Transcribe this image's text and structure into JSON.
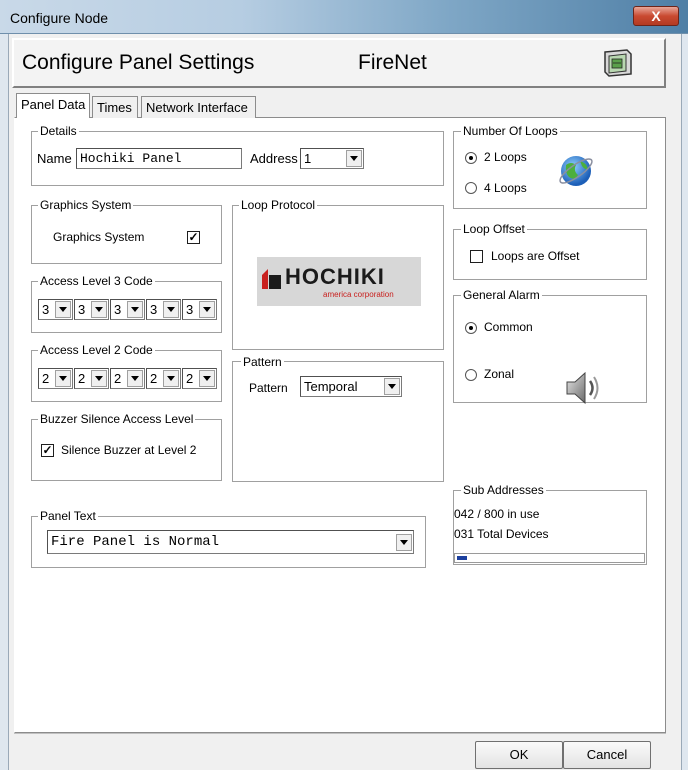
{
  "window": {
    "title": "Configure Node",
    "close_label": "X"
  },
  "header": {
    "title": "Configure Panel Settings",
    "network": "FireNet"
  },
  "tabs": [
    "Panel Data",
    "Times",
    "Network Interface"
  ],
  "details": {
    "label": "Details",
    "name_label": "Name",
    "name_value": "Hochiki Panel",
    "address_label": "Address",
    "address_value": "1"
  },
  "number_of_loops": {
    "label": "Number Of Loops",
    "options": [
      "2 Loops",
      "4 Loops"
    ],
    "selected": "2 Loops"
  },
  "graphics_system": {
    "label": "Graphics System",
    "checkbox_label": "Graphics System",
    "checked": true
  },
  "loop_protocol": {
    "label": "Loop Protocol",
    "logo_text": "HOCHIKI",
    "logo_sub": "america corporation"
  },
  "loop_offset": {
    "label": "Loop Offset",
    "checkbox_label": "Loops are Offset",
    "checked": false
  },
  "access_level_3": {
    "label": "Access Level 3 Code",
    "digits": [
      "3",
      "3",
      "3",
      "3",
      "3"
    ]
  },
  "access_level_2": {
    "label": "Access Level 2 Code",
    "digits": [
      "2",
      "2",
      "2",
      "2",
      "2"
    ]
  },
  "general_alarm": {
    "label": "General Alarm",
    "options": [
      "Common",
      "Zonal"
    ],
    "selected": "Common"
  },
  "pattern": {
    "label": "Pattern",
    "field_label": "Pattern",
    "value": "Temporal"
  },
  "buzzer": {
    "label": "Buzzer Silence Access Level",
    "checkbox_label": "Silence Buzzer at Level 2",
    "checked": true
  },
  "sub_addresses": {
    "label": "Sub Addresses",
    "in_use": "042 / 800  in use",
    "total": "031 Total Devices",
    "usage_fraction": 0.0525
  },
  "panel_text": {
    "label": "Panel Text",
    "value": "Fire Panel is Normal"
  },
  "buttons": {
    "ok": "OK",
    "cancel": "Cancel"
  },
  "colors": {
    "logo_red": "#c8201e",
    "globe_blue": "#1d5fb8",
    "progress_blue": "#1c3f9e"
  }
}
